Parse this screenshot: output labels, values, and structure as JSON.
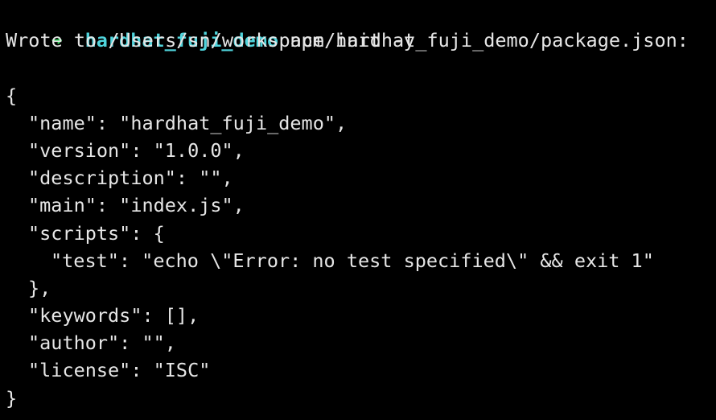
{
  "prompt": {
    "arrow": "➜",
    "cwd": "hardhat_fuji_demo",
    "command": " npm init -y"
  },
  "output": {
    "wrote_line": "Wrote to /Users/sn/workspace/hardhat_fuji_demo/package.json:",
    "open_brace": "{",
    "name_line": "\"name\": \"hardhat_fuji_demo\",",
    "version_line": "\"version\": \"1.0.0\",",
    "description_line": "\"description\": \"\",",
    "main_line": "\"main\": \"index.js\",",
    "scripts_open": "\"scripts\": {",
    "test_line": "\"test\": \"echo \\\"Error: no test specified\\\" && exit 1\"",
    "scripts_close": "},",
    "keywords_line": "\"keywords\": [],",
    "author_line": "\"author\": \"\",",
    "license_line": "\"license\": \"ISC\"",
    "close_brace": "}"
  },
  "colors": {
    "background": "#000000",
    "text": "#e6e6e6",
    "arrow": "#2fd35a",
    "cwd": "#4fd4dc"
  }
}
